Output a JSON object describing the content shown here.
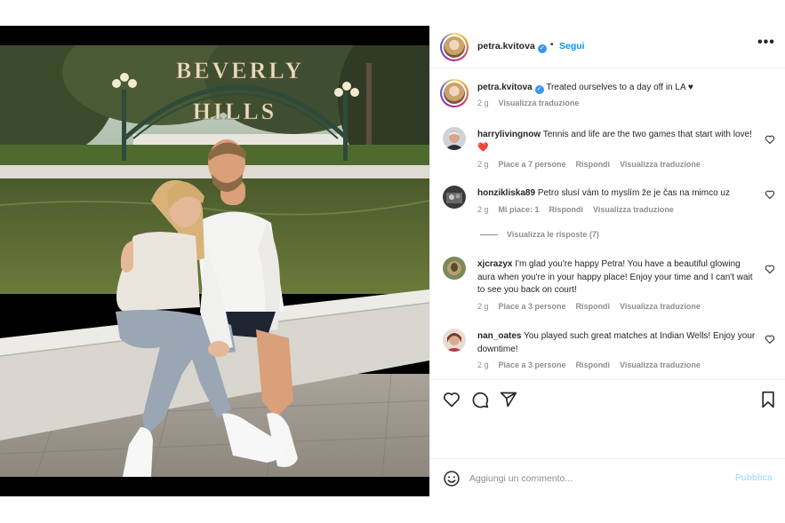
{
  "post": {
    "username": "petra.kvitova",
    "separator": "•",
    "follow_label": "Segui",
    "more_label": "•••",
    "verified_mark": "✓"
  },
  "photo": {
    "sign_line1": "BEVERLY",
    "sign_line2": "HILLS"
  },
  "caption": {
    "username": "petra.kvitova",
    "text": "Treated ourselves to a day off in LA ♥",
    "time": "2 g",
    "translate": "Visualizza traduzione"
  },
  "comments": [
    {
      "username": "harrylivingnow",
      "text": "Tennis and life are the two games that start with love! ❤️",
      "time": "2 g",
      "likes": "Piace a 7 persone",
      "reply": "Rispondi",
      "translate": "Visualizza traduzione"
    },
    {
      "username": "honzikliska89",
      "text": "Petro slusí vám to myslím že je čas na mimco uz",
      "time": "2 g",
      "likes": "Mi piace: 1",
      "reply": "Rispondi",
      "translate": "Visualizza traduzione",
      "view_replies": "Visualizza le risposte (7)"
    },
    {
      "username": "xjcrazyx",
      "text": "I'm glad you're happy Petra! You have a beautiful glowing aura when you're in your happy place! Enjoy your time and I can't wait to see you back on court!",
      "time": "2 g",
      "likes": "Piace a 3 persone",
      "reply": "Rispondi",
      "translate": "Visualizza traduzione"
    },
    {
      "username": "nan_oates",
      "text": "You played such great matches at Indian Wells! Enjoy your downtime!",
      "time": "2 g",
      "likes": "Piace a 3 persone",
      "reply": "Rispondi",
      "translate": "Visualizza traduzione"
    }
  ],
  "add_comment": {
    "placeholder": "Aggiungi un commento...",
    "publish_label": "Pubblica"
  },
  "colors": {
    "accent": "#0095f6",
    "verified": "#3897f0",
    "muted": "#8e8e8e",
    "publish_disabled": "#b2dffc",
    "heart_red": "#ed4956"
  },
  "icons": {
    "like": "heart-icon",
    "comment": "comment-bubble-icon",
    "share": "paper-plane-icon",
    "save": "bookmark-icon",
    "emoji": "smiley-icon",
    "more": "ellipsis-icon"
  }
}
